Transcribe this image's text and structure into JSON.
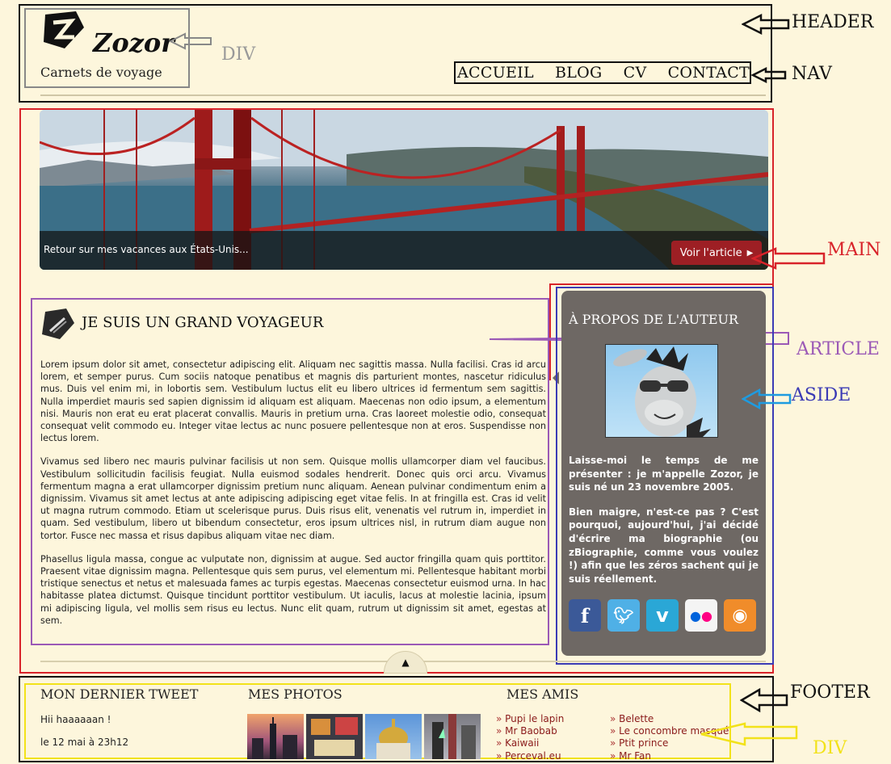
{
  "header": {
    "logo_text": "Zozor",
    "subtitle": "Carnets de voyage"
  },
  "nav": {
    "items": [
      "ACCUEIL",
      "BLOG",
      "CV",
      "CONTACT"
    ]
  },
  "annotations": {
    "header": "HEADER",
    "div_header": "DIV",
    "nav": "NAV",
    "main": "MAIN",
    "article": "ARTICLE",
    "aside": "ASIDE",
    "footer": "FOOTER",
    "div_footer": "DIV"
  },
  "banner": {
    "caption": "Retour sur mes vacances aux États-Unis...",
    "button_label": "Voir l'article"
  },
  "article": {
    "title": "JE SUIS UN GRAND VOYAGEUR",
    "paragraphs": [
      "Lorem ipsum dolor sit amet, consectetur adipiscing elit. Aliquam nec sagittis massa. Nulla facilisi. Cras id arcu lorem, et semper purus. Cum sociis natoque penatibus et magnis dis parturient montes, nascetur ridiculus mus. Duis vel enim mi, in lobortis sem. Vestibulum luctus elit eu libero ultrices id fermentum sem sagittis. Nulla imperdiet mauris sed sapien dignissim id aliquam est aliquam. Maecenas non odio ipsum, a elementum nisi. Mauris non erat eu erat placerat convallis. Mauris in pretium urna. Cras laoreet molestie odio, consequat consequat velit commodo eu. Integer vitae lectus ac nunc posuere pellentesque non at eros. Suspendisse non lectus lorem.",
      "Vivamus sed libero nec mauris pulvinar facilisis ut non sem. Quisque mollis ullamcorper diam vel faucibus. Vestibulum sollicitudin facilisis feugiat. Nulla euismod sodales hendrerit. Donec quis orci arcu. Vivamus fermentum magna a erat ullamcorper dignissim pretium nunc aliquam. Aenean pulvinar condimentum enim a dignissim. Vivamus sit amet lectus at ante adipiscing adipiscing eget vitae felis. In at fringilla est. Cras id velit ut magna rutrum commodo. Etiam ut scelerisque purus. Duis risus elit, venenatis vel rutrum in, imperdiet in quam. Sed vestibulum, libero ut bibendum consectetur, eros ipsum ultrices nisl, in rutrum diam augue non tortor. Fusce nec massa et risus dapibus aliquam vitae nec diam.",
      "Phasellus ligula massa, congue ac vulputate non, dignissim at augue. Sed auctor fringilla quam quis porttitor. Praesent vitae dignissim magna. Pellentesque quis sem purus, vel elementum mi. Pellentesque habitant morbi tristique senectus et netus et malesuada fames ac turpis egestas. Maecenas consectetur euismod urna. In hac habitasse platea dictumst. Quisque tincidunt porttitor vestibulum. Ut iaculis, lacus at molestie lacinia, ipsum mi adipiscing ligula, vel mollis sem risus eu lectus. Nunc elit quam, rutrum ut dignissim sit amet, egestas at sem."
    ]
  },
  "aside": {
    "title": "À PROPOS DE L'AUTEUR",
    "paragraphs": [
      "Laisse-moi le temps de me présenter : je m'appelle Zozor, je suis né un 23 novembre 2005.",
      "Bien maigre, n'est-ce pas ? C'est pourquoi, aujourd'hui, j'ai décidé d'écrire ma biographie (ou zBiographie, comme vous voulez !) afin que les zéros sachent qui je suis réellement."
    ],
    "social": [
      {
        "name": "facebook-icon",
        "glyph": "f",
        "color": "#3b5998"
      },
      {
        "name": "twitter-icon",
        "glyph": "t",
        "color": "#4fb0e6"
      },
      {
        "name": "vimeo-icon",
        "glyph": "v",
        "color": "#2aa7d6"
      },
      {
        "name": "flickr-icon",
        "glyph": "●●",
        "color": "#f4f4f4"
      },
      {
        "name": "rss-icon",
        "glyph": "◉",
        "color": "#f08c2a"
      }
    ]
  },
  "footer": {
    "tweet_title": "MON DERNIER TWEET",
    "tweet_text": "Hii haaaaaan !",
    "tweet_date": "le 12 mai à 23h12",
    "photos_title": "MES PHOTOS",
    "friends_title": "MES AMIS",
    "friends_col1": [
      "Pupi le lapin",
      "Mr Baobab",
      "Kaiwaii",
      "Perceval.eu"
    ],
    "friends_col2": [
      "Belette",
      "Le concombre masqué",
      "Ptit prince",
      "Mr Fan"
    ]
  }
}
